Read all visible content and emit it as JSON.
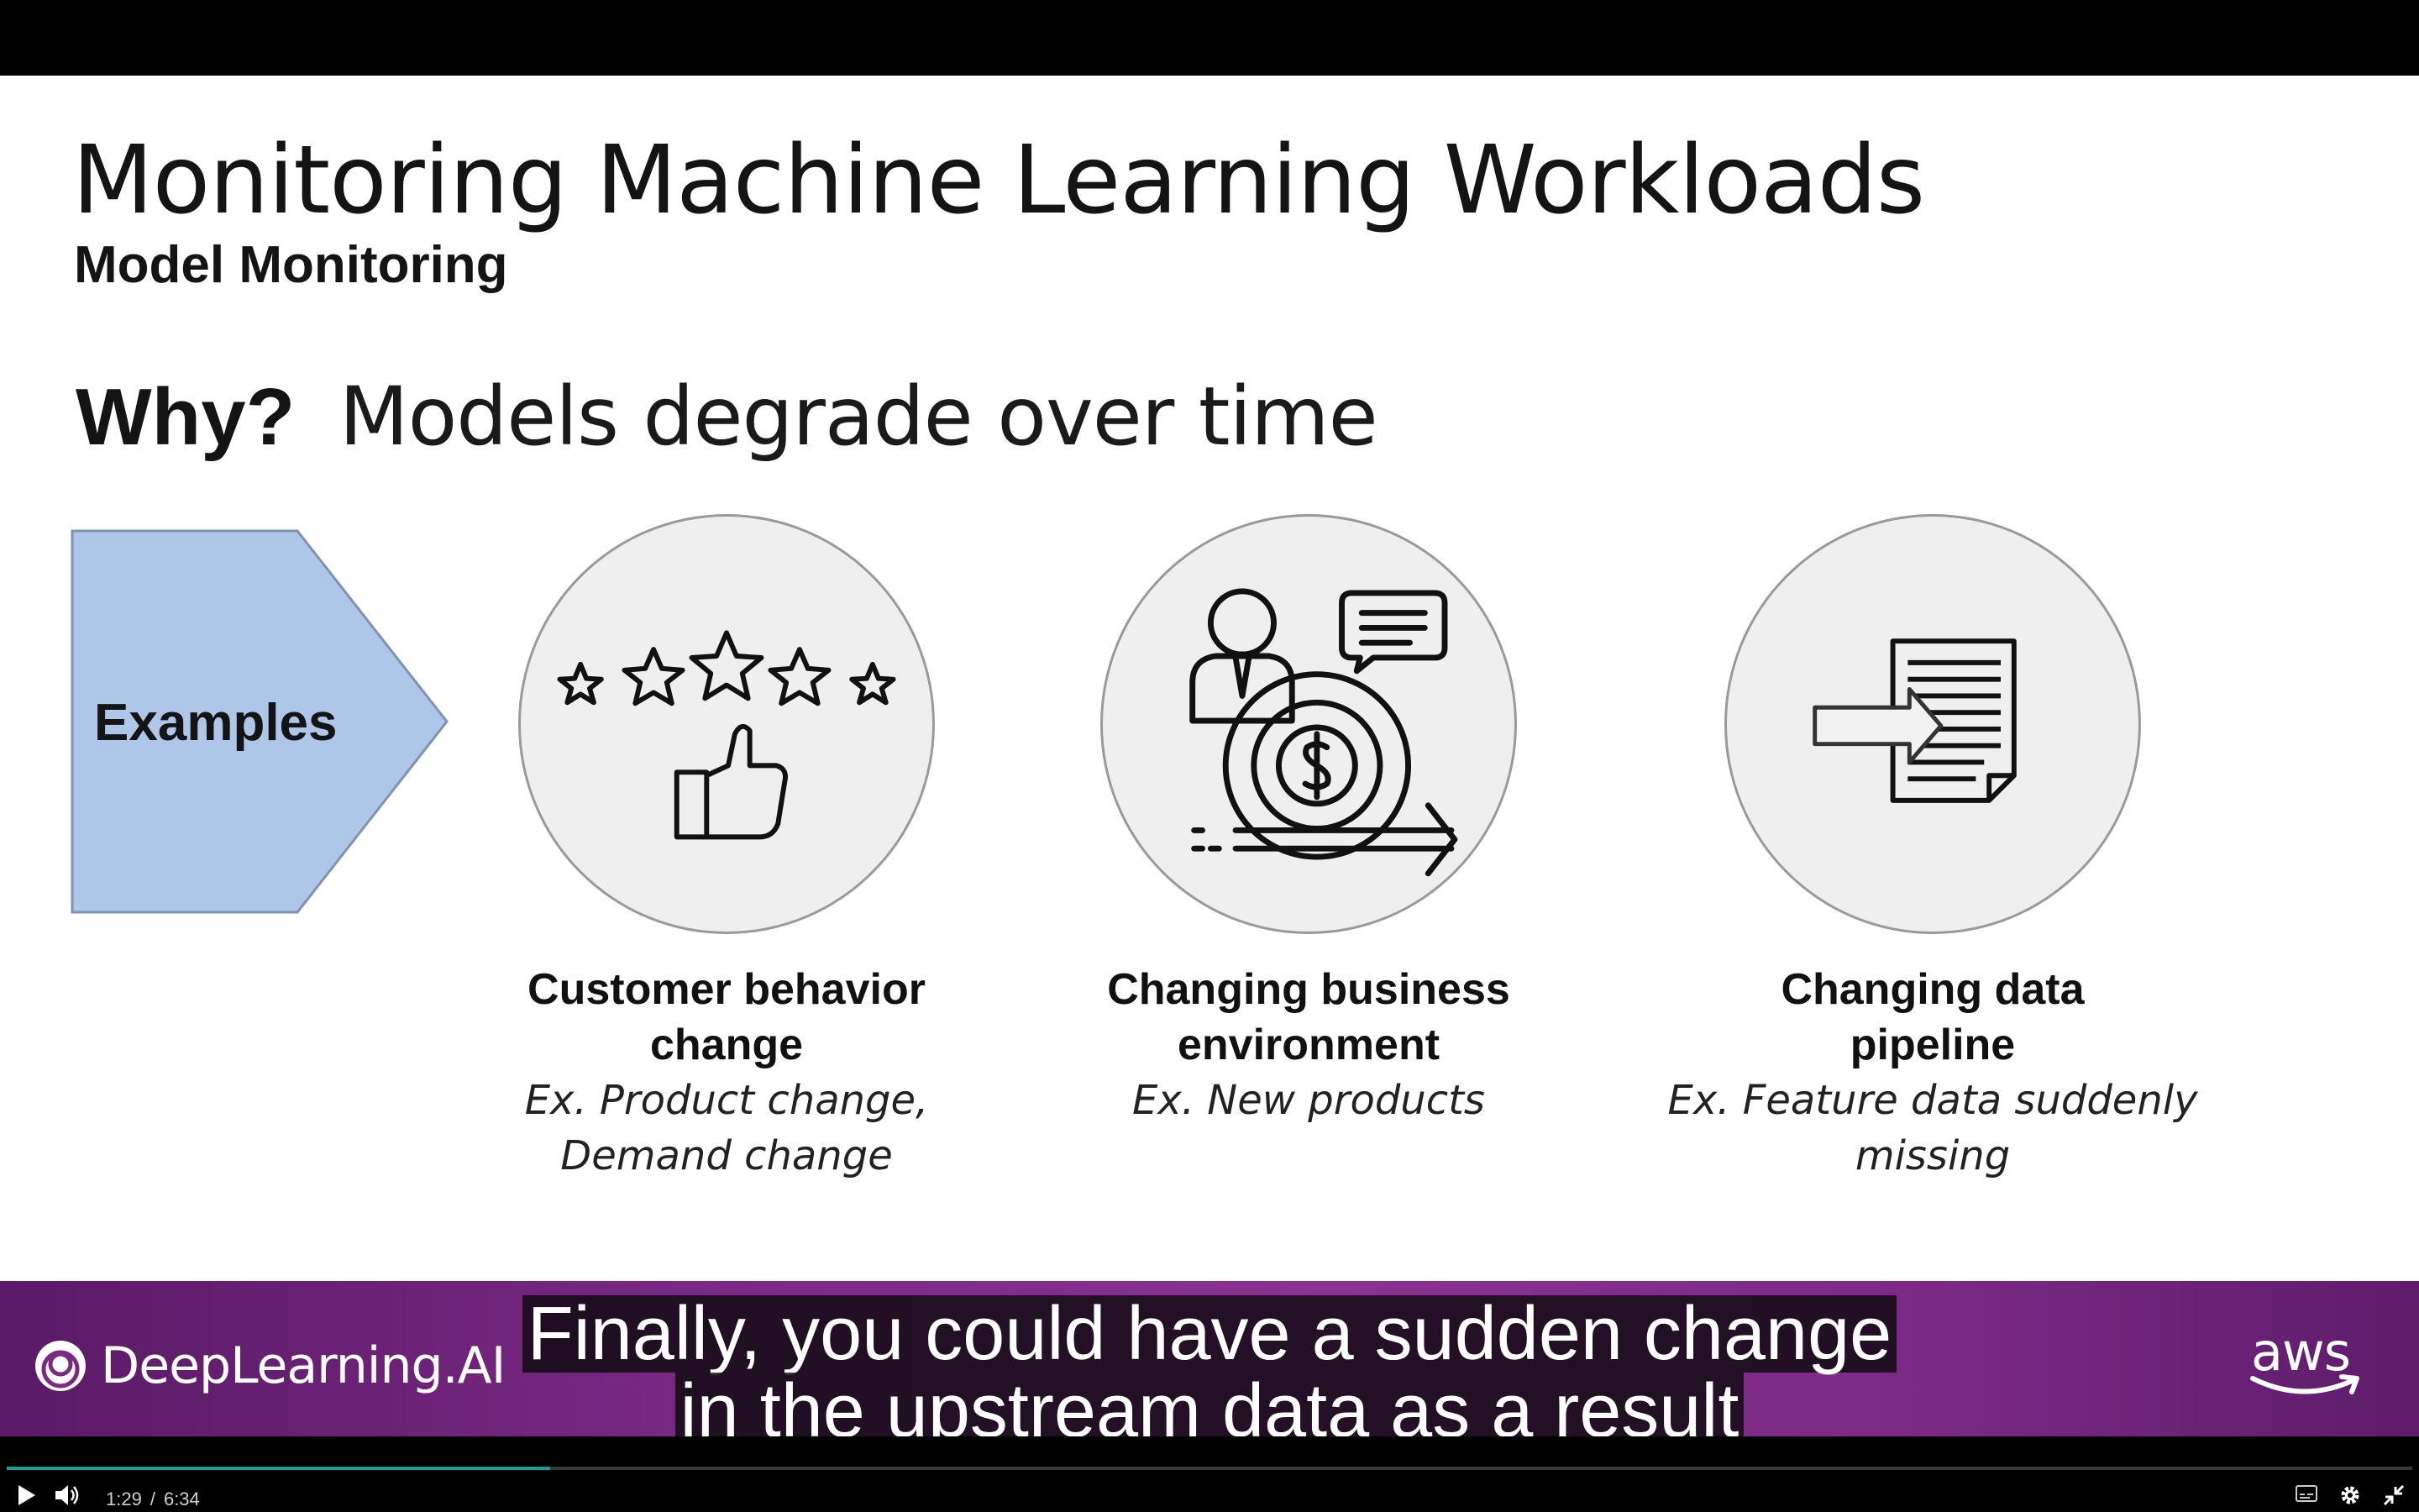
{
  "slide": {
    "title": "Monitoring Machine Learning Workloads",
    "subtitle": "Model Monitoring",
    "why_label": "Why?",
    "why_text": "Models degrade over time",
    "examples_label": "Examples",
    "examples": [
      {
        "icon": "rating-thumbs-up-icon",
        "heading_lines": [
          "Customer behavior",
          "change"
        ],
        "example_lines": [
          "Ex. Product change,",
          "Demand change"
        ]
      },
      {
        "icon": "businessman-money-icon",
        "heading_lines": [
          "Changing business",
          "environment"
        ],
        "example_lines": [
          "Ex. New products"
        ]
      },
      {
        "icon": "data-pipeline-document-icon",
        "heading_lines": [
          "Changing data",
          "pipeline"
        ],
        "example_lines": [
          "Ex. Feature data suddenly",
          "missing"
        ]
      }
    ]
  },
  "footer": {
    "left_logo": "DeepLearning.AI",
    "right_logo": "aws"
  },
  "captions": {
    "lines": [
      "Finally, you could have a sudden change",
      "in the upstream data as a result"
    ]
  },
  "controls": {
    "current_time": "1:29",
    "separator": "/",
    "duration": "6:34",
    "progress": 0.226
  },
  "colors": {
    "examples_arrow": "#aec6e8",
    "footer_purple": "#7a2a85",
    "progress": "#1f9e8d"
  }
}
